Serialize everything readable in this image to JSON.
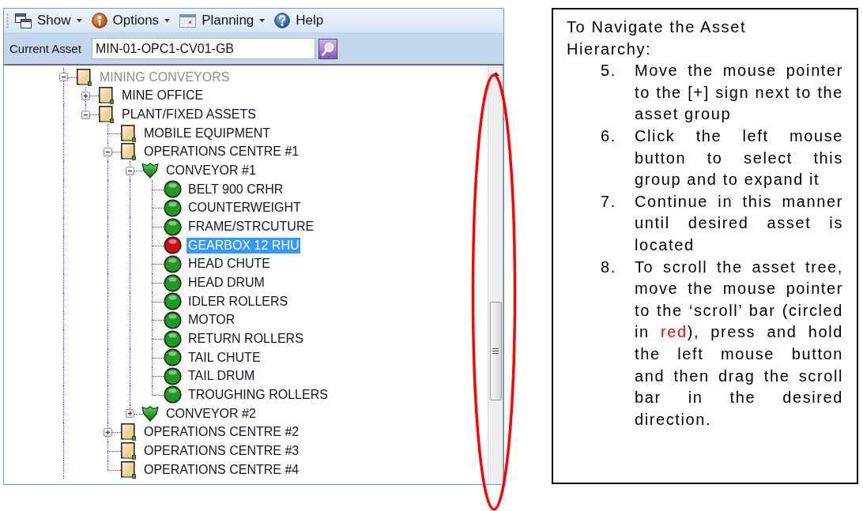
{
  "toolbar": {
    "items": [
      {
        "label": "Show",
        "dropdown": true
      },
      {
        "label": "Options",
        "dropdown": true
      },
      {
        "label": "Planning",
        "dropdown": true
      },
      {
        "label": "Help",
        "dropdown": false
      }
    ]
  },
  "asset_bar": {
    "label": "Current Asset",
    "value": "MIN-01-OPC1-CV01-GB"
  },
  "tree": {
    "nodes": [
      {
        "label": "MINING CONVEYORS",
        "kind": "folder",
        "expanded": true,
        "selected": false,
        "disabled": true,
        "children": [
          {
            "label": "MINE OFFICE",
            "kind": "folder",
            "expanded": false,
            "selected": false,
            "disabled": false
          },
          {
            "label": "PLANT/FIXED ASSETS",
            "kind": "folder",
            "expanded": true,
            "selected": false,
            "disabled": false,
            "children": [
              {
                "label": "MOBILE EQUIPMENT",
                "kind": "folder",
                "selected": false,
                "disabled": false
              },
              {
                "label": "OPERATIONS CENTRE #1",
                "kind": "folder",
                "expanded": true,
                "selected": false,
                "disabled": false,
                "children": [
                  {
                    "label": "CONVEYOR #1",
                    "kind": "shield",
                    "expanded": true,
                    "selected": false,
                    "disabled": false,
                    "children": [
                      {
                        "label": "BELT 900 CRHR",
                        "kind": "status",
                        "color": "#1e9a1e",
                        "selected": false,
                        "disabled": false
                      },
                      {
                        "label": "COUNTERWEIGHT",
                        "kind": "status",
                        "color": "#1e9a1e",
                        "selected": false,
                        "disabled": false
                      },
                      {
                        "label": "FRAME/STRCUTURE",
                        "kind": "status",
                        "color": "#1e9a1e",
                        "selected": false,
                        "disabled": false
                      },
                      {
                        "label": "GEARBOX 12 RHU",
                        "kind": "status",
                        "color": "#cc1111",
                        "selected": true,
                        "disabled": false
                      },
                      {
                        "label": "HEAD CHUTE",
                        "kind": "status",
                        "color": "#1e9a1e",
                        "selected": false,
                        "disabled": false
                      },
                      {
                        "label": "HEAD DRUM",
                        "kind": "status",
                        "color": "#1e9a1e",
                        "selected": false,
                        "disabled": false
                      },
                      {
                        "label": "IDLER ROLLERS",
                        "kind": "status",
                        "color": "#1e9a1e",
                        "selected": false,
                        "disabled": false
                      },
                      {
                        "label": "MOTOR",
                        "kind": "status",
                        "color": "#1e9a1e",
                        "selected": false,
                        "disabled": false
                      },
                      {
                        "label": "RETURN ROLLERS",
                        "kind": "status",
                        "color": "#1e9a1e",
                        "selected": false,
                        "disabled": false
                      },
                      {
                        "label": "TAIL CHUTE",
                        "kind": "status",
                        "color": "#1e9a1e",
                        "selected": false,
                        "disabled": false
                      },
                      {
                        "label": "TAIL DRUM",
                        "kind": "status",
                        "color": "#1e9a1e",
                        "selected": false,
                        "disabled": false
                      },
                      {
                        "label": "TROUGHING ROLLERS",
                        "kind": "status",
                        "color": "#1e9a1e",
                        "selected": false,
                        "disabled": false
                      }
                    ]
                  },
                  {
                    "label": "CONVEYOR #2",
                    "kind": "shield",
                    "expanded": false,
                    "selected": false,
                    "disabled": false
                  }
                ]
              },
              {
                "label": "OPERATIONS CENTRE #2",
                "kind": "folder",
                "expanded": false,
                "selected": false,
                "disabled": false
              },
              {
                "label": "OPERATIONS CENTRE #3",
                "kind": "folder",
                "selected": false,
                "disabled": false
              },
              {
                "label": "OPERATIONS CENTRE #4",
                "kind": "folder",
                "selected": false,
                "disabled": false
              }
            ]
          }
        ]
      }
    ]
  },
  "instructions": {
    "title": "To Navigate the Asset Hierarchy:",
    "steps": [
      {
        "number": "5.",
        "segments": [
          {
            "text": "Move the mouse pointer to the [+] sign next to the asset group"
          }
        ]
      },
      {
        "number": "6.",
        "segments": [
          {
            "text": "Click the left mouse button to select this group and to expand it"
          }
        ]
      },
      {
        "number": "7.",
        "segments": [
          {
            "text": "Continue in this manner until desired asset is located"
          }
        ]
      },
      {
        "number": "8.",
        "segments": [
          {
            "text": "To scroll the asset tree, move the mouse pointer to the ‘scroll’ bar (circled in "
          },
          {
            "text": "red",
            "color": "#ff0000"
          },
          {
            "text": "), press and hold the left mouse button and then drag the scroll bar in the desired direction."
          }
        ]
      }
    ]
  }
}
